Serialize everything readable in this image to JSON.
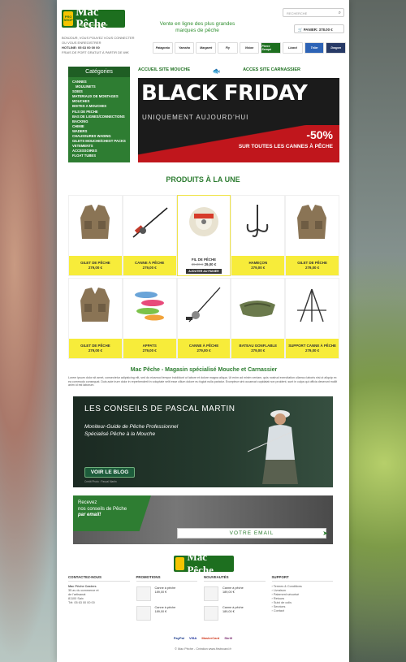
{
  "header": {
    "logo_badge": "PRO SHOP",
    "logo_name": "Mac Pêche",
    "logo_tag": "Magasin spécialisé pêche",
    "tagline": "Vente en ligne des plus grandes marques de pêche",
    "search_placeholder": "RECHERCHE",
    "cart_label": "PANIER: 378.00 €",
    "info_lines": [
      "BONJOUR, VOUS POUVEZ VOUS CONNECTER",
      "OU VOUS ENREGISTRER",
      "HOTLINE: 05 63 00 00 00",
      "FRAIS DE PORT GRATUIT À PARTIR DE 69€"
    ],
    "brands": [
      "Patagonia",
      "Yamaha",
      "Margaret",
      "Fly",
      "Vision",
      "Pierre Sempé",
      "Lizard",
      "Tribe",
      "Dragon"
    ]
  },
  "topnav": {
    "left": "ACCUEIL SITE MOUCHE",
    "right": "ACCES SITE CARNASSIER"
  },
  "sidebar": {
    "title": "Catégories",
    "items": [
      "CANNES",
      "MOULINETS",
      "SOIES",
      "MATERIAUX DE MONTAGES",
      "MOUCHES",
      "BOITES A MOUCHES",
      "FILS DE PECHE",
      "BAS DE LIGNES/CONNECTIONS",
      "BACKING",
      "CHIMIE",
      "WADERS",
      "CHAUSSURES WADING",
      "GILETS MOUCHE/CHEST PACKS",
      "VETEMENTS",
      "ACCESSOIRES",
      "FLOAT TUBES"
    ]
  },
  "banner": {
    "title": "BLACK FRIDAY",
    "subtitle": "UNIQUEMENT AUJOURD'HUI",
    "discount": "-50%",
    "promo": "SUR TOUTES LES CANNES À PÊCHE"
  },
  "featured_title": "PRODUITS À LA UNE",
  "products": [
    {
      "name": "GILET DE PÊCHE",
      "price": "279,00 €",
      "old": "",
      "thumb": "vest"
    },
    {
      "name": "CANNE À PÊCHE",
      "price": "279,00 €",
      "old": "",
      "thumb": "rod"
    },
    {
      "name": "FIL DE PÊCHE",
      "price": "29,00 €",
      "old": "39,00 €",
      "thumb": "line",
      "add": "AJOUTER AU PANIER"
    },
    {
      "name": "HAMEÇON",
      "price": "279,00 €",
      "old": "",
      "thumb": "hook"
    },
    {
      "name": "GILET DE PÊCHE",
      "price": "279,00 €",
      "old": "",
      "thumb": "vest"
    },
    {
      "name": "GILET DE PÊCHE",
      "price": "279,00 €",
      "old": "",
      "thumb": "vest"
    },
    {
      "name": "APPATS",
      "price": "279,00 €",
      "old": "",
      "thumb": "lures"
    },
    {
      "name": "CANNE À PÊCHE",
      "price": "279,00 €",
      "old": "",
      "thumb": "rod2"
    },
    {
      "name": "BATEAU GONFLABLE",
      "price": "279,00 €",
      "old": "",
      "thumb": "boat"
    },
    {
      "name": "SUPPORT CANNE À PÊCHE",
      "price": "279,00 €",
      "old": "",
      "thumb": "stand"
    }
  ],
  "about": {
    "title": "Mac Pêche - Magasin spécialisé Mouche et Carnassier",
    "text": "Lorem ipsum dolor sit amet, consectetur adipisicing elit, sed do eiusmod tempor incididunt ut labore et dolore magna aliqua. Ut enim ad minim veniam, quis nostrud exercitation ullamco laboris nisi ut aliquip ex ea commodo consequat. Duis aute irure dolor in reprehenderit in voluptate velit esse cillum dolore eu fugiat nulla pariatur. Excepteur sint occaecat cupidatat non proident, sunt in culpa qui officia deserunt mollit anim id est laborum."
  },
  "blog": {
    "title": "LES CONSEILS DE PASCAL MARTIN",
    "sub1": "Moniteur-Guide de Pêche Professionnel",
    "sub2": "Spécialisé Pêche à la Mouche",
    "button": "VOIR LE BLOG",
    "credit": "Crédit Photo : Pascal Martin"
  },
  "newsletter": {
    "line1": "Recevez",
    "line2": "nos conseils de Pêche",
    "line3": "par email!",
    "placeholder": "VOTRE EMAIL"
  },
  "footer": {
    "logo_name": "Mac Pêche",
    "contact_title": "CONTACTEZ-NOUS",
    "contact_lines": [
      "Mac Pêche Castres",
      "",
      "35 av du commerce et",
      "de l'artisanat",
      "81100 Saix",
      "Tél: 05 63 00 00 00"
    ],
    "promo_title": "PROMOTIONS",
    "new_title": "NOUVEAUTÉS",
    "support_title": "SUPPORT",
    "product_name": "Canne à pêche",
    "product_price": "189,00 €",
    "support_links": [
      "Termes & Conditions",
      "Livraison",
      "Paiement sécurisé",
      "Retours",
      "Suivi de colis",
      "Services",
      "Contact"
    ],
    "payments": [
      "PayPal",
      "VISA",
      "MasterCard",
      "Skrill"
    ],
    "copyright": "© Mac Pêche - Création www.firstncard.fr"
  },
  "colors": {
    "brand_green": "#2e7d32",
    "promo_yellow": "#f7ec3a",
    "sale_red": "#c0161c"
  }
}
